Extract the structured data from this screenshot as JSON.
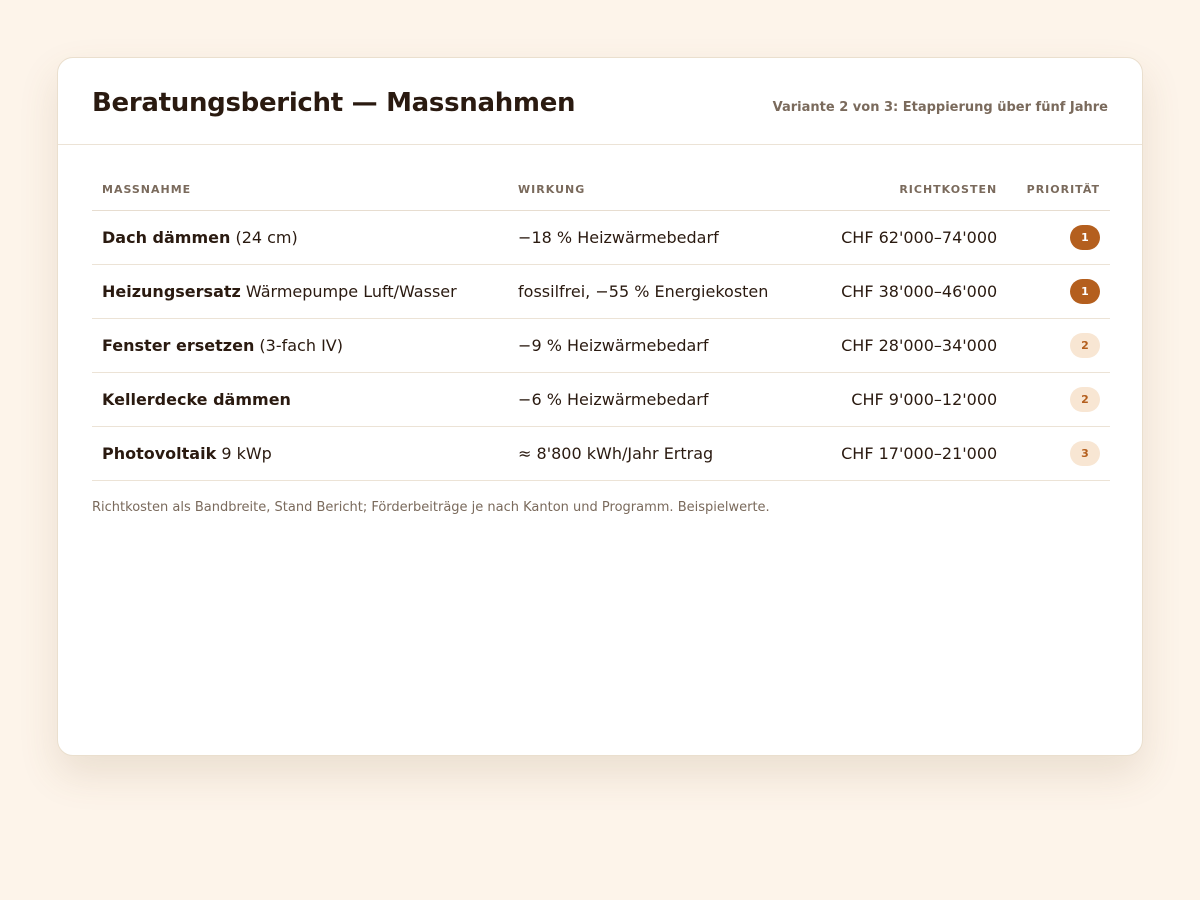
{
  "header": {
    "title": "Beratungsbericht — Massnahmen",
    "subtitle": "Variante 2 von 3: Etappierung über fünf Jahre"
  },
  "table": {
    "columns": [
      "MASSNAHME",
      "WIRKUNG",
      "RICHTKOSTEN",
      "PRIORITÄT"
    ],
    "rows": [
      {
        "name": "Dach dämmen",
        "detail": " (24 cm)",
        "wirkung": "−18 % Heizwärmebedarf",
        "kosten": "CHF 62'000–74'000",
        "prio": "1"
      },
      {
        "name": "Heizungsersatz",
        "detail": " Wärmepumpe Luft/Wasser",
        "wirkung": "fossilfrei, −55 % Energiekosten",
        "kosten": "CHF 38'000–46'000",
        "prio": "1"
      },
      {
        "name": "Fenster ersetzen",
        "detail": " (3-fach IV)",
        "wirkung": "−9 % Heizwärmebedarf",
        "kosten": "CHF 28'000–34'000",
        "prio": "2"
      },
      {
        "name": "Kellerdecke dämmen",
        "detail": "",
        "wirkung": "−6 % Heizwärmebedarf",
        "kosten": "CHF 9'000–12'000",
        "prio": "2"
      },
      {
        "name": "Photovoltaik",
        "detail": " 9 kWp",
        "wirkung": "≈ 8'800 kWh/Jahr Ertrag",
        "kosten": "CHF 17'000–21'000",
        "prio": "3"
      }
    ]
  },
  "footnote": "Richtkosten als Bandbreite, Stand Bericht; Förderbeiträge je nach Kanton und Programm. Beispielwerte.",
  "colors": {
    "accent": "#b45f1e",
    "badge_light": "#f8e6d3",
    "background": "#fdf4ea"
  }
}
